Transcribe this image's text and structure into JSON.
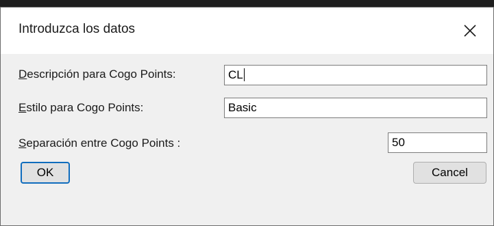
{
  "dialog": {
    "title": "Introduzca los datos",
    "close_icon": "close-icon"
  },
  "fields": {
    "descripcion": {
      "label_underlined": "D",
      "label_rest": "escripción para Cogo Points:",
      "value": "CL"
    },
    "estilo": {
      "label_underlined": "E",
      "label_rest": "stilo para Cogo Points:",
      "value": "Basic"
    },
    "separacion": {
      "label_underlined": "S",
      "label_rest": "eparación entre Cogo Points :",
      "value": "50"
    }
  },
  "buttons": {
    "ok_label": "OK",
    "cancel_label": "Cancel"
  }
}
